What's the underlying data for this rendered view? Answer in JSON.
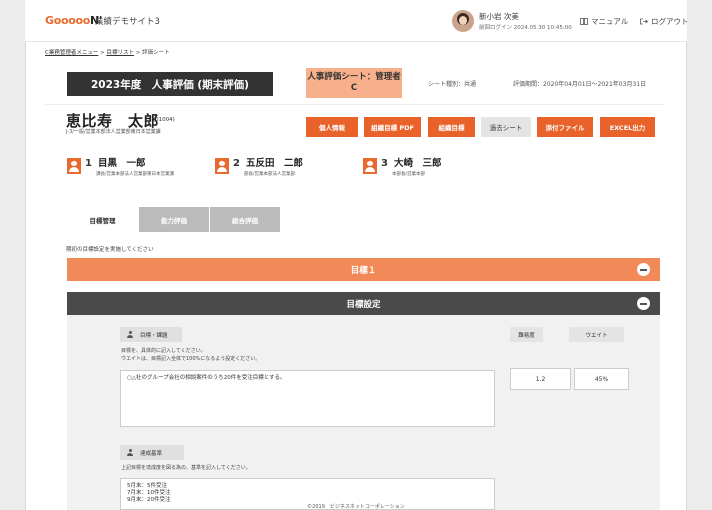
{
  "header": {
    "logo_main": "Gooooo",
    "logo_n": "N'",
    "site_name": "業績デモサイト3",
    "user_name": "新小岩 次美",
    "last_login": "前回ログイン 2024.05.30 10:45:00",
    "manual_label": "マニュアル",
    "logout_label": "ログアウト"
  },
  "breadcrumb": {
    "item1": "C業務管理者メニュー",
    "sep": ">",
    "item2": "目標リスト",
    "item3": "評価シート"
  },
  "sheet": {
    "title": "2023年度　人事評価 (期末評価)",
    "sheet_name": "人事評価シート：管理者C",
    "sheet_type": "シート種別：共通",
    "period": "評価期間：2020年04月01日～2021年03月31日"
  },
  "person": {
    "name": "恵比寿　太郎",
    "id": "(01004)",
    "dept": "J-3/一般/営業本部法人営業部東日本営業課"
  },
  "actions": {
    "personal_info": "個人情報",
    "print_pdf": "組織目標 PDF",
    "org_goal": "組織目標",
    "past_sheet": "過去シート",
    "attachment": "添付ファイル",
    "excel": "EXCEL出力"
  },
  "approvers": [
    {
      "num": "1",
      "name": "目黒　一郎",
      "role": "課長/営業本部法人営業部東日本営業課"
    },
    {
      "num": "2",
      "name": "五反田　二郎",
      "role": "部長/営業本部法人営業部"
    },
    {
      "num": "3",
      "name": "大崎　三郎",
      "role": "本部長/営業本部"
    }
  ],
  "tabs": [
    "目標管理",
    "能力評価",
    "総合評価"
  ],
  "instruction": "期初の目標設定を実施してください",
  "goal_header": "目標１",
  "section_header": "目標設定",
  "goal": {
    "theme_label": "目標・課題",
    "difficulty_label": "難易度",
    "weight_label": "ウエイト",
    "desc_line1": "目標を、具体的に記入してください。",
    "desc_line2": "ウエイトは、目標記入全体で100%になるよう設定ください。",
    "text": "○△社のグループ会社の相談案件のうち20件を受注目標とする。",
    "difficulty": "1.2",
    "weight": "45%",
    "criteria_label": "達成基準",
    "criteria_desc": "上記目標を達成度を図る為の、基準を記入してください。",
    "criteria_lines": [
      "5月末：5件受注",
      "7月末：10件受注",
      "9月末：20件受注"
    ]
  },
  "footer": "©2019　ビジネスネットコーポレーション"
}
